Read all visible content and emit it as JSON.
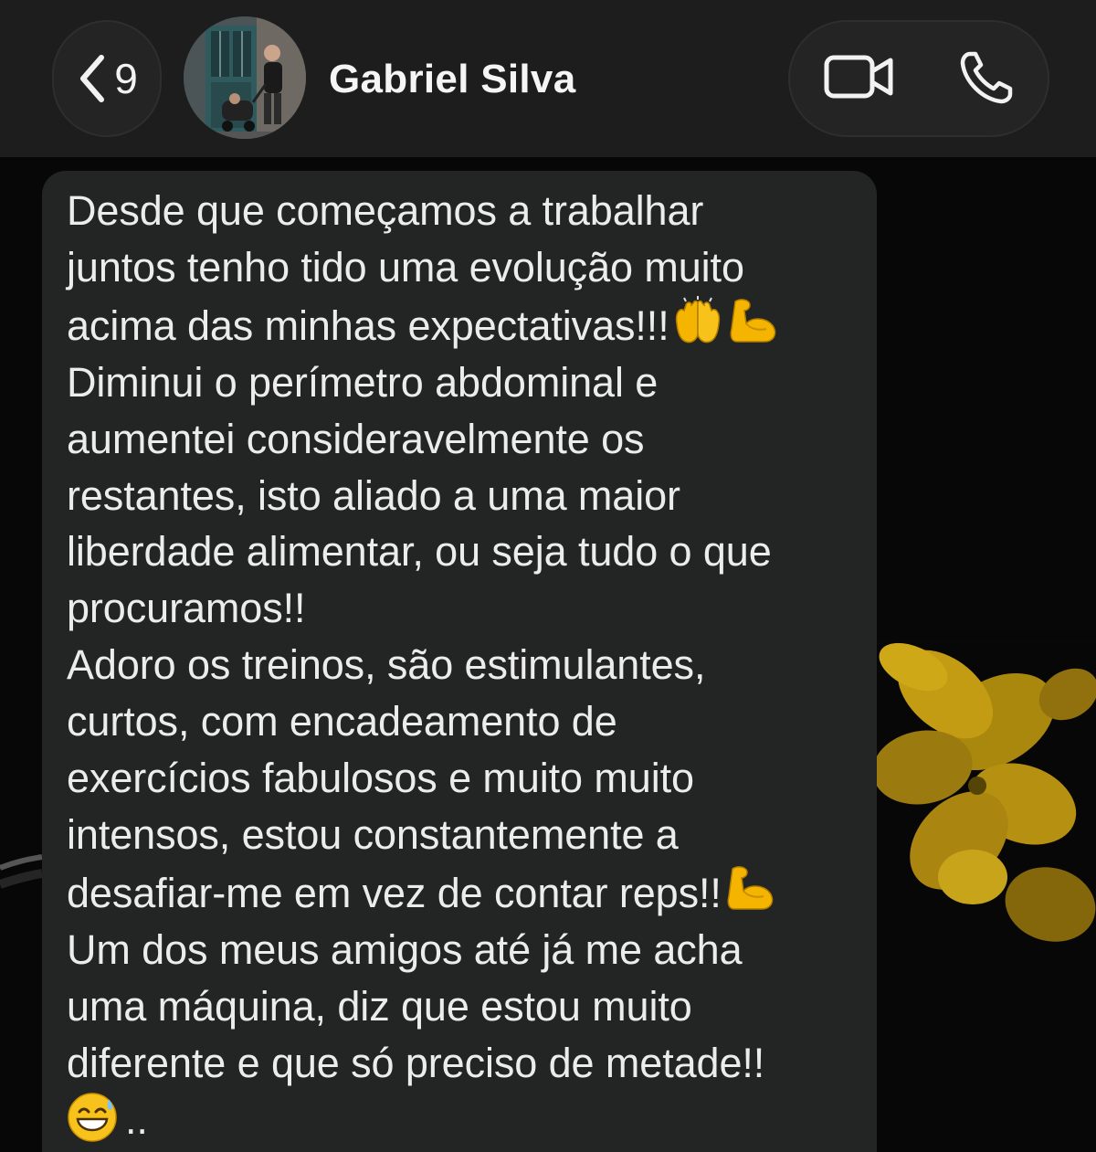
{
  "header": {
    "back_label": "<",
    "unread_count": "9",
    "contact_name": "Gabriel Silva",
    "video_call_icon": "video-camera-icon",
    "voice_call_icon": "phone-icon"
  },
  "message": {
    "lines": [
      "Desde que começamos a trabalhar",
      "juntos tenho tido uma evolução muito",
      "acima das minhas expectativas!!!",
      "Diminui o perímetro abdominal e",
      "aumentei consideravelmente os",
      "restantes, isto aliado a uma maior",
      "liberdade alimentar, ou seja tudo o que",
      "procuramos!!",
      "Adoro os treinos, são estimulantes,",
      "curtos,  com encadeamento de",
      "exercícios fabulosos e muito muito",
      "intensos, estou constantemente a",
      "desafiar-me em vez de contar reps!!",
      "Um dos meus amigos até já me acha",
      "uma máquina, diz que estou muito",
      "diferente e que só preciso de metade!!",
      ".."
    ],
    "emojis": {
      "line3": [
        "raising-hands-emoji",
        "flexed-biceps-emoji"
      ],
      "line13": [
        "flexed-biceps-emoji"
      ],
      "line17": [
        "grinning-sweat-emoji"
      ]
    }
  },
  "colors": {
    "header_bg": "#1d1d1d",
    "bubble_bg": "#232424",
    "text": "#ececec",
    "wallpaper_flower": "#c9a20f"
  }
}
